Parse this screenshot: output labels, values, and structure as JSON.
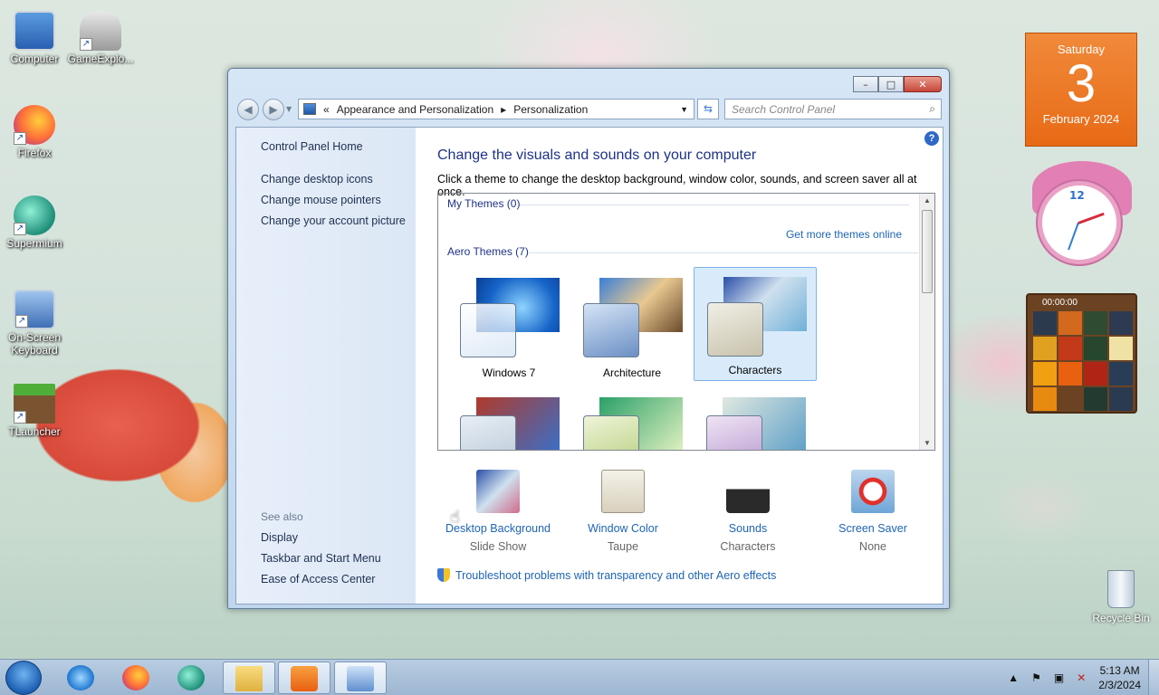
{
  "desktop": {
    "icons": [
      {
        "label": "Computer",
        "icon": "computer-icon"
      },
      {
        "label": "GameExplo...",
        "icon": "game-explorer-icon"
      },
      {
        "label": "Firefox",
        "icon": "firefox-icon"
      },
      {
        "label": "Supermium",
        "icon": "supermium-icon"
      },
      {
        "label": "On-Screen Keyboard",
        "icon": "keyboard-icon"
      },
      {
        "label": "TLauncher",
        "icon": "tlauncher-icon"
      }
    ],
    "recycle_bin": "Recycle Bin"
  },
  "gadgets": {
    "calendar": {
      "weekday": "Saturday",
      "day": "3",
      "month_year": "February 2024"
    },
    "clock": {
      "numeral": "12"
    },
    "puzzle": {
      "timer": "00:00:00"
    }
  },
  "window": {
    "caption": {
      "minimize": "–",
      "maximize": "□",
      "close": "✕"
    },
    "address": {
      "chevron": "«",
      "crumbs": [
        "Appearance and Personalization",
        "Personalization"
      ],
      "separator": "▸"
    },
    "search": {
      "placeholder": "Search Control Panel"
    },
    "sidebar": {
      "home": "Control Panel Home",
      "links": [
        "Change desktop icons",
        "Change mouse pointers",
        "Change your account picture"
      ],
      "see_also_title": "See also",
      "see_also": [
        "Display",
        "Taskbar and Start Menu",
        "Ease of Access Center"
      ]
    },
    "main": {
      "title": "Change the visuals and sounds on your computer",
      "subtitle": "Click a theme to change the desktop background, window color, sounds, and screen saver all at once.",
      "my_themes": "My Themes (0)",
      "get_more": "Get more themes online",
      "aero_themes": "Aero Themes (7)",
      "themes": [
        "Windows 7",
        "Architecture",
        "Characters"
      ],
      "selected_theme": "Characters",
      "bottom": [
        {
          "title": "Desktop Background",
          "value": "Slide Show"
        },
        {
          "title": "Window Color",
          "value": "Taupe"
        },
        {
          "title": "Sounds",
          "value": "Characters"
        },
        {
          "title": "Screen Saver",
          "value": "None"
        }
      ],
      "troubleshoot": "Troubleshoot problems with transparency and other Aero effects"
    }
  },
  "taskbar": {
    "time": "5:13 AM",
    "date": "2/3/2024",
    "tray_up": "▲"
  },
  "colors": {
    "link": "#1e64b4",
    "title": "#1e3287",
    "calendar": "#e86a16"
  }
}
